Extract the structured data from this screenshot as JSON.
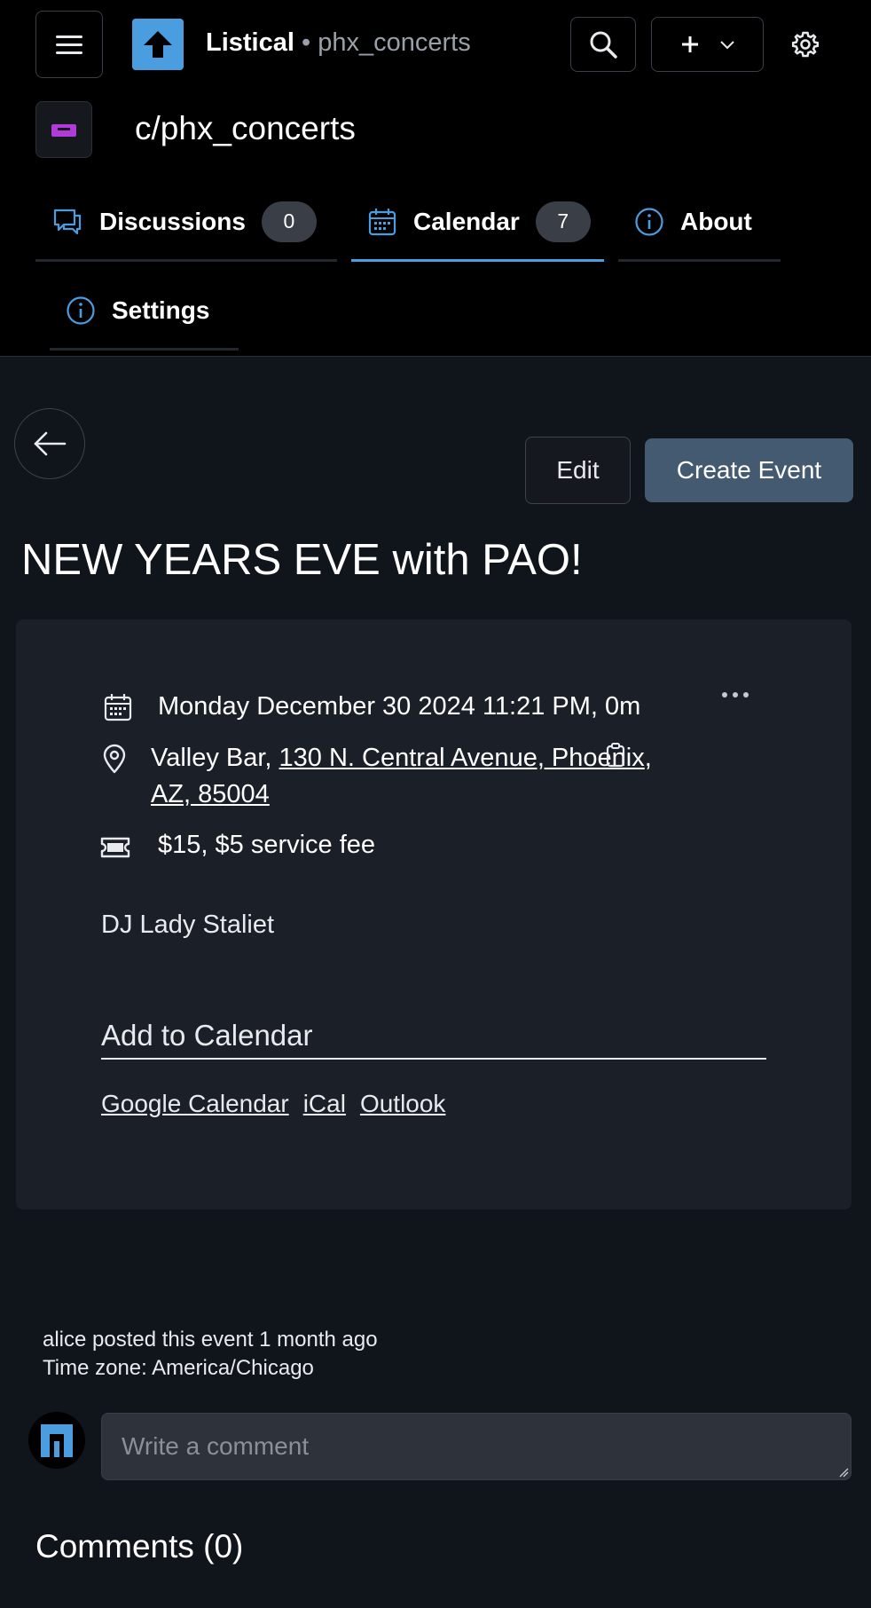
{
  "header": {
    "app_name": "Listical",
    "separator": "•",
    "subtitle": "phx_concerts",
    "community_title": "c/phx_concerts"
  },
  "tabs": [
    {
      "label": "Discussions",
      "count": "0",
      "icon": "chat-bubbles-icon"
    },
    {
      "label": "Calendar",
      "count": "7",
      "icon": "calendar-icon",
      "active": true
    },
    {
      "label": "About",
      "icon": "info-icon"
    },
    {
      "label": "Settings",
      "icon": "info-icon"
    }
  ],
  "actions": {
    "edit_label": "Edit",
    "create_label": "Create Event"
  },
  "event": {
    "title": "NEW YEARS EVE with PAO!",
    "datetime": "Monday December 30 2024 11:21 PM, 0m",
    "venue": "Valley Bar, ",
    "address_part1": "130 N. Central Avenue, Phoenix",
    "address_comma": ",",
    "address_part2": "AZ, 85004",
    "price": "$15, $5 service fee",
    "description": "DJ Lady Staliet"
  },
  "add_to_calendar": {
    "heading": "Add to Calendar",
    "links": [
      "Google Calendar",
      "iCal",
      "Outlook"
    ]
  },
  "footer": {
    "posted_by": "alice posted this event 1 month ago",
    "timezone": "Time zone: America/Chicago",
    "comment_placeholder": "Write a comment",
    "comments_heading": "Comments (0)"
  },
  "colors": {
    "accent": "#4a9ee0",
    "primary_button": "#445a70",
    "background": "#10141b",
    "card": "#1a1f28",
    "community_icon": "#b03bd8"
  }
}
